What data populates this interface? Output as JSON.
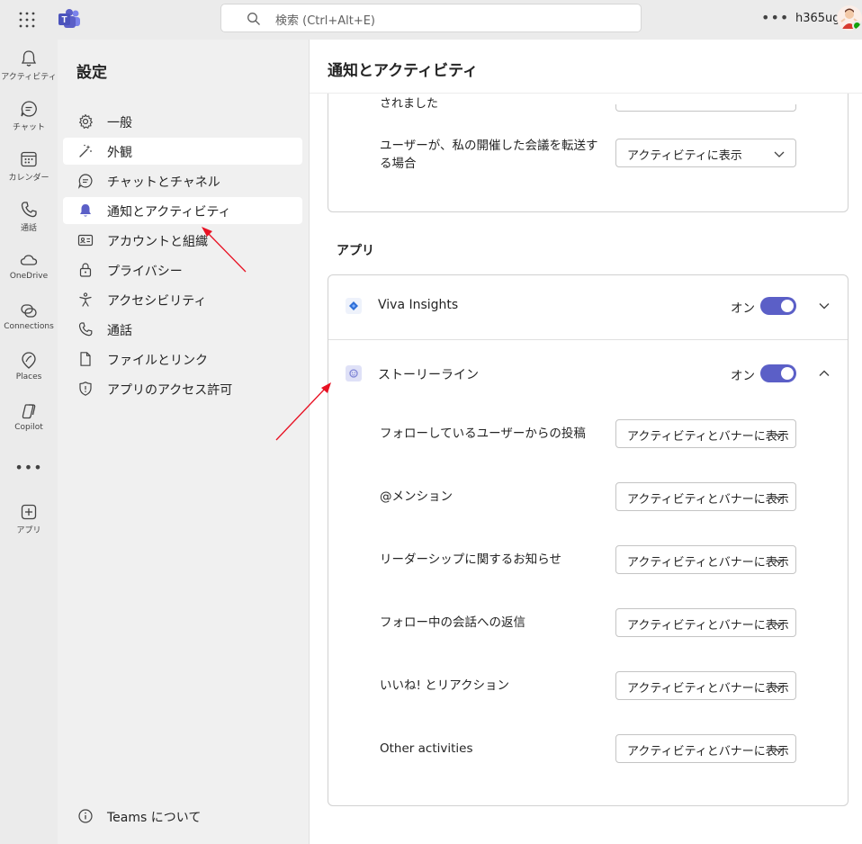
{
  "topbar": {
    "search_placeholder": "検索 (Ctrl+Alt+E)",
    "more_label": "•••",
    "tenant": "h365ug",
    "icons": [
      "waffle-icon",
      "teams-logo-icon",
      "search-icon",
      "more-icon",
      "avatar"
    ]
  },
  "rail": {
    "items": [
      {
        "label": "アクティビティ",
        "icon": "bell-icon"
      },
      {
        "label": "チャット",
        "icon": "chat-icon"
      },
      {
        "label": "カレンダー",
        "icon": "calendar-icon"
      },
      {
        "label": "通話",
        "icon": "phone-icon"
      },
      {
        "label": "OneDrive",
        "icon": "cloud-icon"
      },
      {
        "label": "Connections",
        "icon": "connections-icon"
      },
      {
        "label": "Places",
        "icon": "places-icon"
      },
      {
        "label": "Copilot",
        "icon": "copilot-icon"
      },
      {
        "label": "アプリ",
        "icon": "add-app-icon"
      }
    ],
    "more": "•••"
  },
  "settings": {
    "title": "設定",
    "items": [
      {
        "label": "一般",
        "icon": "gear-icon"
      },
      {
        "label": "外観",
        "icon": "wand-icon"
      },
      {
        "label": "チャットとチャネル",
        "icon": "chat-icon"
      },
      {
        "label": "通知とアクティビティ",
        "icon": "bell-filled-icon"
      },
      {
        "label": "アカウントと組織",
        "icon": "id-card-icon"
      },
      {
        "label": "プライバシー",
        "icon": "lock-icon"
      },
      {
        "label": "アクセシビリティ",
        "icon": "accessibility-icon"
      },
      {
        "label": "通話",
        "icon": "phone-icon"
      },
      {
        "label": "ファイルとリンク",
        "icon": "document-icon"
      },
      {
        "label": "アプリのアクセス許可",
        "icon": "shield-icon"
      }
    ],
    "selected_index": 3,
    "about": "Teams について"
  },
  "content": {
    "title": "通知とアクティビティ",
    "top_card": {
      "partial_text": "されました",
      "row": {
        "label": "ユーザーが、私の開催した会議を転送する場合",
        "value": "アクティビティに表示"
      }
    },
    "apps_heading": "アプリ",
    "apps": [
      {
        "name": "Viva Insights",
        "state": "オン",
        "enabled": true,
        "expanded": false,
        "color": "#2f6fd6"
      },
      {
        "name": "ストーリーライン",
        "state": "オン",
        "enabled": true,
        "expanded": true,
        "color": "#8a8fe0"
      }
    ],
    "storyline_rows": [
      {
        "label": "フォローしているユーザーからの投稿",
        "value": "アクティビティとバナーに表示"
      },
      {
        "label": "@メンション",
        "value": "アクティビティとバナーに表示"
      },
      {
        "label": "リーダーシップに関するお知らせ",
        "value": "アクティビティとバナーに表示"
      },
      {
        "label": "フォロー中の会話への返信",
        "value": "アクティビティとバナーに表示"
      },
      {
        "label": "いいね! とリアクション",
        "value": "アクティビティとバナーに表示"
      },
      {
        "label": "Other activities",
        "value": "アクティビティとバナーに表示"
      }
    ]
  },
  "colors": {
    "accent": "#5b5fc7",
    "annotation_arrow": "#e81123"
  }
}
